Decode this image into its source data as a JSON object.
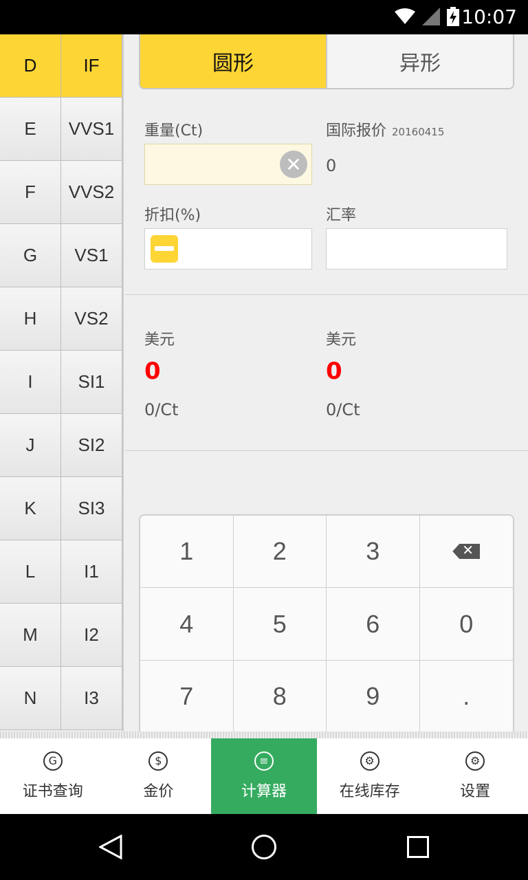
{
  "status_bar": {
    "time": "10:07",
    "icons": [
      "wifi-icon",
      "signal-icon",
      "battery-charging-icon"
    ]
  },
  "grades": [
    {
      "color": "D",
      "clarity": "IF",
      "selected": true
    },
    {
      "color": "E",
      "clarity": "VVS1"
    },
    {
      "color": "F",
      "clarity": "VVS2"
    },
    {
      "color": "G",
      "clarity": "VS1"
    },
    {
      "color": "H",
      "clarity": "VS2"
    },
    {
      "color": "I",
      "clarity": "SI1"
    },
    {
      "color": "J",
      "clarity": "SI2"
    },
    {
      "color": "K",
      "clarity": "SI3"
    },
    {
      "color": "L",
      "clarity": "I1"
    },
    {
      "color": "M",
      "clarity": "I2"
    },
    {
      "color": "N",
      "clarity": "I3"
    }
  ],
  "shape_tabs": {
    "round": "圆形",
    "fancy": "异形"
  },
  "form": {
    "weight_label": "重量(Ct)",
    "price_label": "国际报价",
    "price_date": "20160415",
    "price_value": "0",
    "discount_label": "折扣(%)",
    "rate_label": "汇率"
  },
  "results": {
    "left_currency": "美元",
    "left_total": "0",
    "left_per_ct": "0/Ct",
    "right_currency": "美元",
    "right_total": "0",
    "right_per_ct": "0/Ct"
  },
  "keypad": [
    "1",
    "2",
    "3",
    "backspace",
    "4",
    "5",
    "6",
    "0",
    "7",
    "8",
    "9",
    "."
  ],
  "bottom_nav": [
    {
      "label": "证书查询",
      "icon": "certificate-icon"
    },
    {
      "label": "金价",
      "icon": "dollar-icon"
    },
    {
      "label": "计算器",
      "icon": "calculator-icon",
      "active": true
    },
    {
      "label": "在线库存",
      "icon": "gear-icon"
    },
    {
      "label": "设置",
      "icon": "settings-icon"
    }
  ],
  "colors": {
    "accent_yellow": "#fdd535",
    "active_green": "#35ab60",
    "result_red": "#ff0000"
  }
}
